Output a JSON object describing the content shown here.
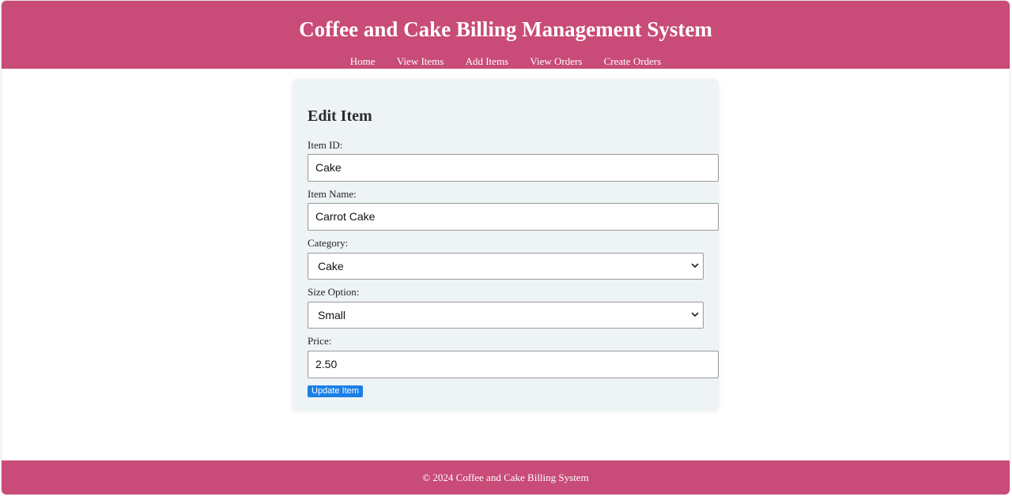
{
  "header": {
    "title": "Coffee and Cake Billing Management System",
    "nav": [
      "Home",
      "View Items",
      "Add Items",
      "View Orders",
      "Create Orders"
    ]
  },
  "form": {
    "title": "Edit Item",
    "item_id": {
      "label": "Item ID:",
      "value": "Cake"
    },
    "item_name": {
      "label": "Item Name:",
      "value": "Carrot Cake"
    },
    "category": {
      "label": "Category:",
      "selected": "Cake"
    },
    "size_option": {
      "label": "Size Option:",
      "selected": "Small"
    },
    "price": {
      "label": "Price:",
      "value": "2.50"
    },
    "submit_label": "Update Item"
  },
  "footer": {
    "text": "© 2024 Coffee and Cake Billing System"
  },
  "colors": {
    "brand": "#c84b78",
    "card_bg": "#eef3f6",
    "button": "#1a7fe6"
  }
}
